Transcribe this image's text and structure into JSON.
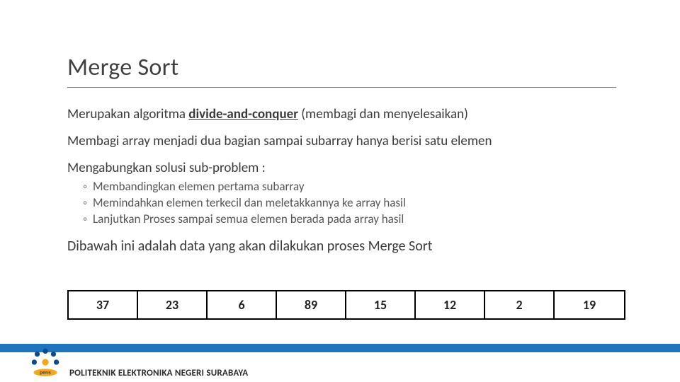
{
  "title": "Merge Sort",
  "para1_prefix": "Merupakan algoritma ",
  "para1_bold": "divide-and-conquer",
  "para1_suffix": " (membagi dan menyelesaikan)",
  "para2": "Membagi array menjadi dua bagian sampai subarray hanya berisi satu elemen",
  "para3": "Mengabungkan solusi sub-problem :",
  "sub": [
    "Membandingkan elemen pertama subarray",
    "Memindahkan elemen terkecil dan meletakkannya ke array hasil",
    "Lanjutkan Proses sampai semua elemen berada pada array hasil"
  ],
  "para4": "Dibawah ini adalah data yang akan dilakukan proses Merge Sort",
  "array": [
    "37",
    "23",
    "6",
    "89",
    "15",
    "12",
    "2",
    "19"
  ],
  "footer": "POLITEKNIK ELEKTRONIKA NEGERI SURABAYA",
  "bullet_glyph": "◦"
}
